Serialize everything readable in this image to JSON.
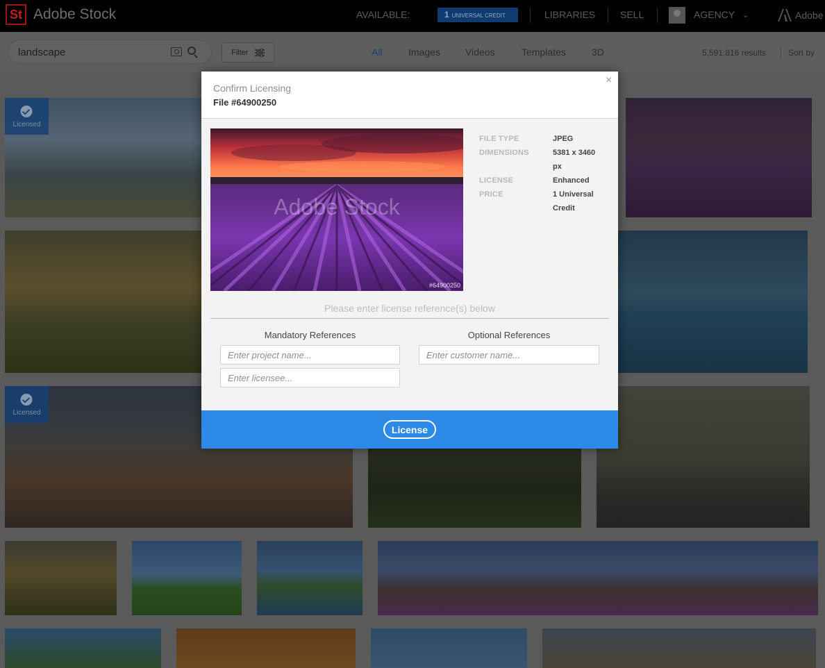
{
  "header": {
    "logo_mark": "St",
    "brand": "Adobe Stock",
    "available_label": "AVAILABLE:",
    "credit_count": "1",
    "credit_label": "UNIVERSAL CREDIT",
    "nav": [
      "LIBRARIES",
      "SELL"
    ],
    "account": "AGENCY",
    "adobe_label": "Adobe"
  },
  "search": {
    "query": "landscape",
    "filter_label": "Filter",
    "tabs": [
      "All",
      "Images",
      "Videos",
      "Templates",
      "3D"
    ],
    "active_tab": "All",
    "results": "5,591,816 results",
    "sort_label": "Sort by"
  },
  "grid": {
    "licensed_label": "Licensed"
  },
  "modal": {
    "title": "Confirm Licensing",
    "file": "File #64900250",
    "watermark": "Adobe Stock",
    "preview_id": "#64900250",
    "details": [
      {
        "key": "FILE TYPE",
        "value": "JPEG"
      },
      {
        "key": "DIMENSIONS",
        "value": "5381 x 3460 px"
      },
      {
        "key": "LICENSE",
        "value": "Enhanced"
      },
      {
        "key": "PRICE",
        "value": "1 Universal Credit"
      }
    ],
    "prompt": "Please enter license reference(s) below",
    "mandatory_header": "Mandatory References",
    "optional_header": "Optional References",
    "project_placeholder": "Enter project name...",
    "licensee_placeholder": "Enter licensee...",
    "customer_placeholder": "Enter customer name...",
    "license_button": "License",
    "close_symbol": "×"
  },
  "colors": {
    "accent_blue": "#2d8ae6",
    "credit_pill": "#0e3c6e",
    "adobe_red": "#c02020"
  }
}
